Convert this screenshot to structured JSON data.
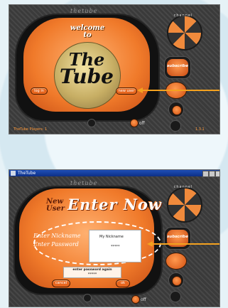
{
  "brand": "thetube",
  "screen1": {
    "welcome_line1": "welcome",
    "welcome_line2": "to",
    "title_line1": "The",
    "title_line2": "Tube",
    "login_button": "log in",
    "new_user_button": "new user",
    "footer_left": "TheTube Players: 1",
    "footer_right": "1.3.1",
    "off_label": "off",
    "subscribe_label": "subscribe",
    "channel_label": "channel",
    "arrow_color": "#f4a21f"
  },
  "screen2": {
    "window_title": "TheTube",
    "new_user_line1": "New",
    "new_user_line2": "User",
    "enter_now": "Enter Now",
    "nickname_label": "Enter Nickname",
    "password_label": "Enter Password",
    "nickname_value": "My Nickname",
    "password_value": "*****",
    "password_again_label": "enter password again",
    "password_again_value": "*****",
    "cancel_button": "cancel",
    "ok_button": "ok",
    "off_label": "off",
    "subscribe_label": "subscribe",
    "channel_label": "channel"
  },
  "colors": {
    "accent_orange": "#e7661e",
    "frame_dark": "#3c3c3c",
    "arrow": "#f4a21f"
  }
}
